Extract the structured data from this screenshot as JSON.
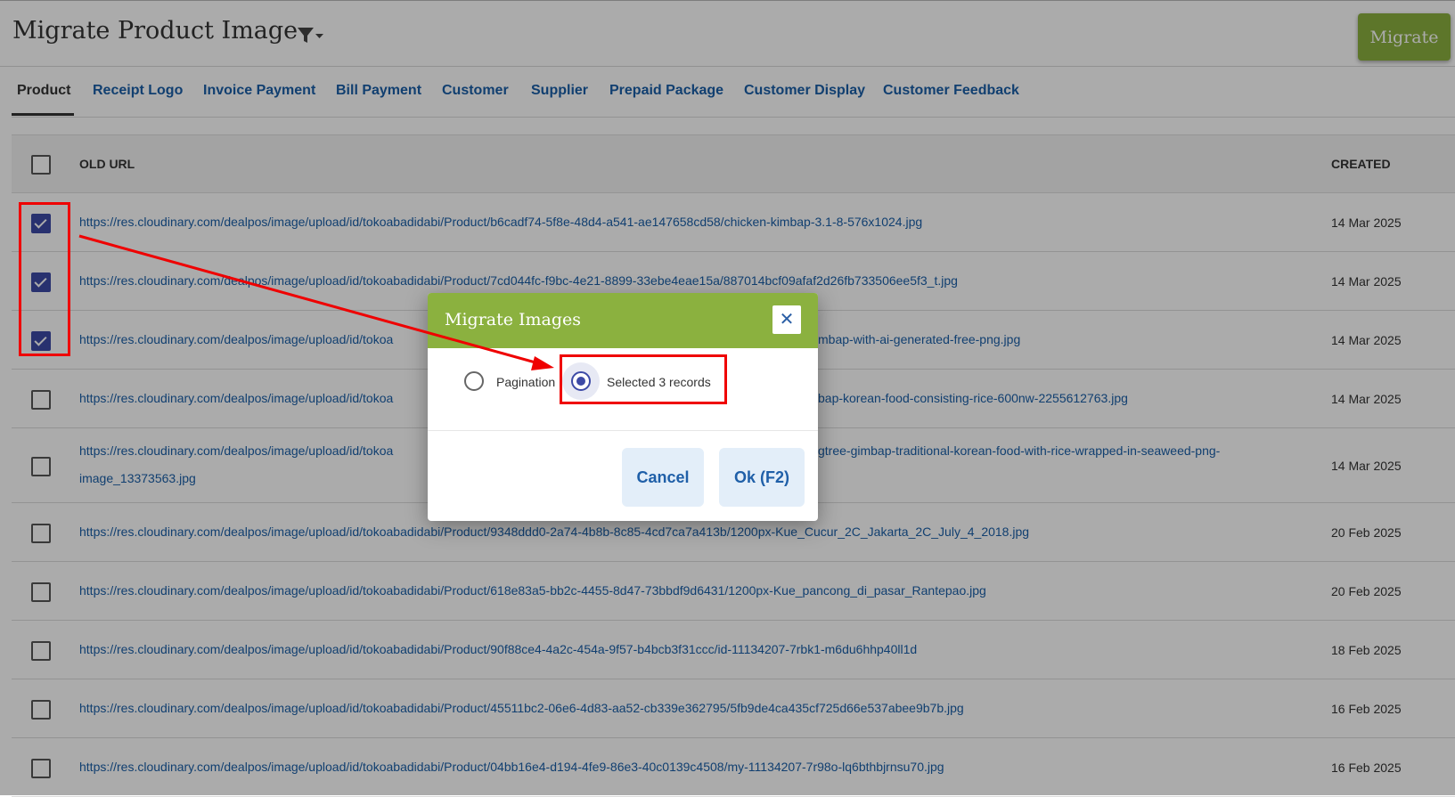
{
  "header": {
    "title": "Migrate Product Image",
    "migrate_label": "Migrate"
  },
  "tabs": [
    {
      "label": "Product"
    },
    {
      "label": "Receipt Logo"
    },
    {
      "label": "Invoice Payment"
    },
    {
      "label": "Bill Payment"
    },
    {
      "label": "Customer"
    },
    {
      "label": "Supplier"
    },
    {
      "label": "Prepaid Package"
    },
    {
      "label": "Customer Display"
    },
    {
      "label": "Customer Feedback"
    }
  ],
  "table": {
    "columns": {
      "url": "OLD URL",
      "created": "CREATED"
    },
    "rows": [
      {
        "url": "https://res.cloudinary.com/dealpos/image/upload/id/tokoabadidabi/Product/b6cadf74-5f8e-48d4-a541-ae147658cd58/chicken-kimbap-3.1-8-576x1024.jpg",
        "created": "14 Mar 2025",
        "checked": true
      },
      {
        "url": "https://res.cloudinary.com/dealpos/image/upload/id/tokoabadidabi/Product/7cd044fc-f9bc-4e21-8899-33ebe4eae15a/887014bcf09afaf2d26fb733506ee5f3_t.jpg",
        "created": "14 Mar 2025",
        "checked": true
      },
      {
        "url": "https://res.cloudinary.com/dealpos/image/upload/id/tokoa",
        "url_tail": "mbap-with-ai-generated-free-png.jpg",
        "created": "14 Mar 2025",
        "checked": true
      },
      {
        "url": "https://res.cloudinary.com/dealpos/image/upload/id/tokoa",
        "url_tail": "bap-korean-food-consisting-rice-600nw-2255612763.jpg",
        "created": "14 Mar 2025",
        "checked": false
      },
      {
        "url": "https://res.cloudinary.com/dealpos/image/upload/id/tokoa",
        "url_tail": "gtree-gimbap-traditional-korean-food-with-rice-wrapped-in-seaweed-png-",
        "url_line2": "image_13373563.jpg",
        "created": "14 Mar 2025",
        "checked": false
      },
      {
        "url": "https://res.cloudinary.com/dealpos/image/upload/id/tokoabadidabi/Product/9348ddd0-2a74-4b8b-8c85-4cd7ca7a413b/1200px-Kue_Cucur_2C_Jakarta_2C_July_4_2018.jpg",
        "created": "20 Feb 2025",
        "checked": false
      },
      {
        "url": "https://res.cloudinary.com/dealpos/image/upload/id/tokoabadidabi/Product/618e83a5-bb2c-4455-8d47-73bbdf9d6431/1200px-Kue_pancong_di_pasar_Rantepao.jpg",
        "created": "20 Feb 2025",
        "checked": false
      },
      {
        "url": "https://res.cloudinary.com/dealpos/image/upload/id/tokoabadidabi/Product/90f88ce4-4a2c-454a-9f57-b4bcb3f31ccc/id-11134207-7rbk1-m6du6hhp40ll1d",
        "created": "18 Feb 2025",
        "checked": false
      },
      {
        "url": "https://res.cloudinary.com/dealpos/image/upload/id/tokoabadidabi/Product/45511bc2-06e6-4d83-aa52-cb339e362795/5fb9de4ca435cf725d66e537abee9b7b.jpg",
        "created": "16 Feb 2025",
        "checked": false
      },
      {
        "url": "https://res.cloudinary.com/dealpos/image/upload/id/tokoabadidabi/Product/04bb16e4-d194-4fe9-86e3-40c0139c4508/my-11134207-7r98o-lq6bthbjrnsu70.jpg",
        "created": "16 Feb 2025",
        "checked": false
      }
    ]
  },
  "dialog": {
    "title": "Migrate Images",
    "close_glyph": "✕",
    "option_pagination": "Pagination",
    "option_selected": "Selected 3 records",
    "cancel_label": "Cancel",
    "ok_label": "Ok (F2)"
  },
  "colors": {
    "accent": "#8bb13f",
    "link": "#1a5fa8",
    "checkbox": "#3d4aa6",
    "highlight": "#ef0000"
  },
  "icons": {
    "filter": "filter-dropdown-icon",
    "close": "close-icon"
  }
}
